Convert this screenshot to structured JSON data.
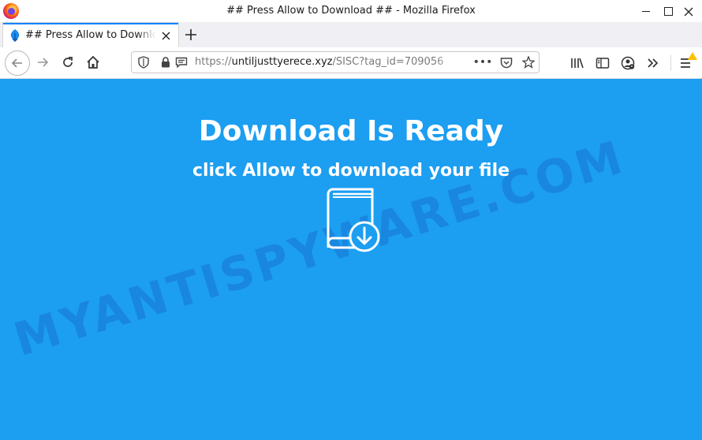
{
  "window": {
    "title": "## Press Allow to Download ## - Mozilla Firefox"
  },
  "tab": {
    "label": "## Press Allow to Download ##"
  },
  "urlbar": {
    "host": "untiljusttyerece.xyz",
    "prefix": "https://",
    "path": "/SISC?tag_id=709056",
    "more": "•••"
  },
  "page": {
    "headline": "Download Is Ready",
    "subline": "click Allow to download your file",
    "watermark": "MYANTISPYWARE.COM",
    "background_color": "#1c9ef1"
  },
  "icons": {
    "browser_logo": "firefox-logo-icon",
    "tab_favicon": "flame-favicon-icon",
    "content": "book-download-icon"
  }
}
